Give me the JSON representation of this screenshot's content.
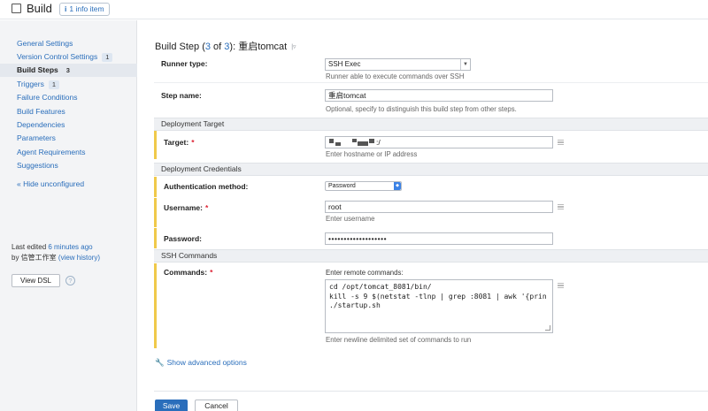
{
  "header": {
    "title": "Build",
    "info_badge": "1 info item",
    "info_icon": "i"
  },
  "sidebar": {
    "items": [
      {
        "label": "General Settings",
        "badge": ""
      },
      {
        "label": "Version Control Settings",
        "badge": "1"
      },
      {
        "label": "Build Steps",
        "badge": "3"
      },
      {
        "label": "Triggers",
        "badge": "1"
      },
      {
        "label": "Failure Conditions",
        "badge": ""
      },
      {
        "label": "Build Features",
        "badge": ""
      },
      {
        "label": "Dependencies",
        "badge": ""
      },
      {
        "label": "Parameters",
        "badge": ""
      },
      {
        "label": "Agent Requirements",
        "badge": ""
      },
      {
        "label": "Suggestions",
        "badge": ""
      }
    ],
    "active_index": 2,
    "hide_unconfigured": "« Hide unconfigured",
    "last_edited_prefix": "Last edited",
    "last_edited_time": "6 minutes ago",
    "last_edited_by": "by 信管工作室",
    "view_history": "(view history)",
    "view_dsl": "View DSL",
    "help_icon": "?"
  },
  "step": {
    "title_prefix": "Build Step (",
    "current": "3",
    "of": " of ",
    "total": "3",
    "title_suffix": "): 重启tomcat"
  },
  "form": {
    "runner_type_label": "Runner type:",
    "runner_type_value": "SSH Exec",
    "runner_type_hint": "Runner able to execute commands over SSH",
    "step_name_label": "Step name:",
    "step_name_value": "重启tomcat",
    "step_name_hint": "Optional, specify to distinguish this build step from other steps.",
    "deployment_target_header": "Deployment Target",
    "target_label": "Target:",
    "target_value_suffix": ":/",
    "target_hint": "Enter hostname or IP address",
    "credentials_header": "Deployment Credentials",
    "auth_method_label": "Authentication method:",
    "auth_method_value": "Password",
    "username_label": "Username:",
    "username_value": "root",
    "username_hint": "Enter username",
    "password_label": "Password:",
    "password_value": "•••••••••••••••••••",
    "ssh_commands_header": "SSH Commands",
    "commands_label": "Commands:",
    "commands_caption": "Enter remote commands:",
    "commands_value": "cd /opt/tomcat_8081/bin/\nkill -s 9 $(netstat -tlnp | grep :8081 | awk '{prin\n./startup.sh",
    "commands_hint": "Enter newline delimited set of commands to run",
    "required_mark": "*"
  },
  "advanced_options": "Show advanced options",
  "buttons": {
    "save": "Save",
    "cancel": "Cancel"
  },
  "colors": {
    "link": "#2a6ebb",
    "accent_bar": "#f0c94a",
    "required": "#dd2233",
    "save_button": "#2a6ebb"
  }
}
